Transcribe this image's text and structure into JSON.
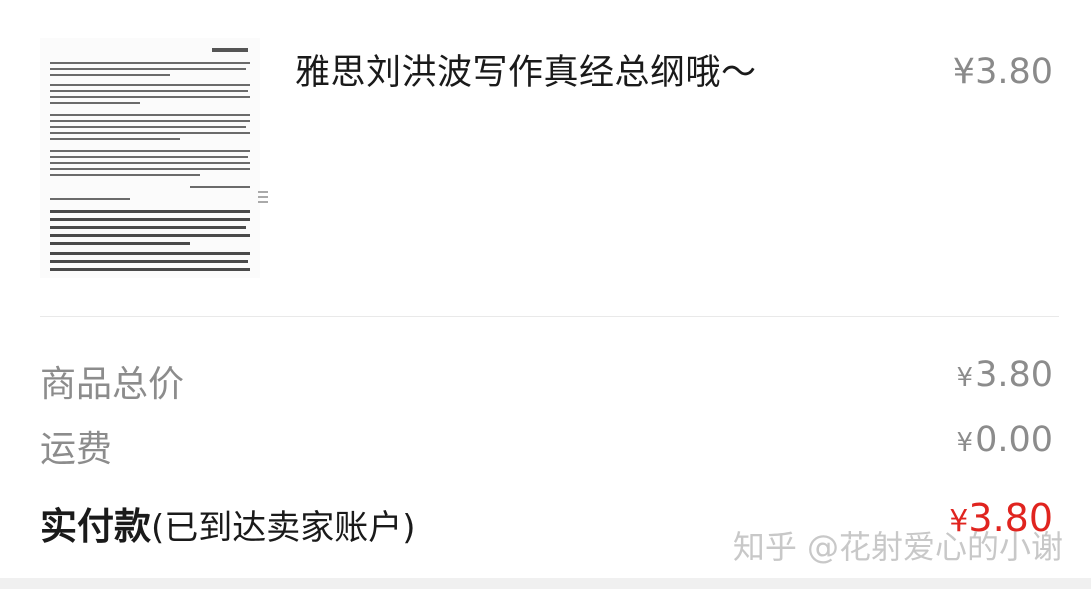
{
  "product": {
    "title": "雅思刘洪波写作真经总纲哦～",
    "price": "¥3.80"
  },
  "summary": {
    "goods_total_label": "商品总价",
    "goods_total_value": "3.80",
    "shipping_label": "运费",
    "shipping_value": "0.00",
    "paid_label": "实付款",
    "paid_note": "(已到达卖家账户)",
    "paid_value": "3.80",
    "currency": "¥"
  },
  "watermark": "知乎 @花射爱心的小谢",
  "colors": {
    "price_red": "#e0241f",
    "muted_text": "#8c8c8c",
    "divider": "#e9e9e9"
  }
}
